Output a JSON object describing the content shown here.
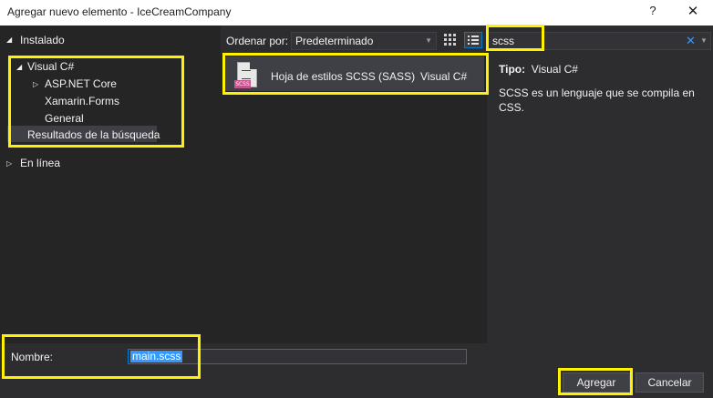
{
  "window": {
    "title": "Agregar nuevo elemento - IceCreamCompany",
    "help_label": "?",
    "close_label": "✕"
  },
  "tree": {
    "installed": "Instalado",
    "visual_csharp": "Visual C#",
    "aspnet_core": "ASP.NET Core",
    "xamarin_forms": "Xamarin.Forms",
    "general": "General",
    "search_results": "Resultados de la búsqueda",
    "online": "En línea"
  },
  "toolbar": {
    "sort_label": "Ordenar por:",
    "sort_value": "Predeterminado",
    "search_value": "scss"
  },
  "items": [
    {
      "name": "Hoja de estilos SCSS (SASS)",
      "language": "Visual C#",
      "badge": "SCSS"
    }
  ],
  "details": {
    "type_label": "Tipo:",
    "type_value": "Visual C#",
    "description": "SCSS es un lenguaje que se compila en CSS."
  },
  "bottom": {
    "name_label": "Nombre:",
    "name_value": "main.scss",
    "add_button": "Agregar",
    "cancel_button": "Cancelar"
  },
  "colors": {
    "highlight": "#fff200",
    "accent": "#007acc",
    "background": "#2d2d30"
  }
}
